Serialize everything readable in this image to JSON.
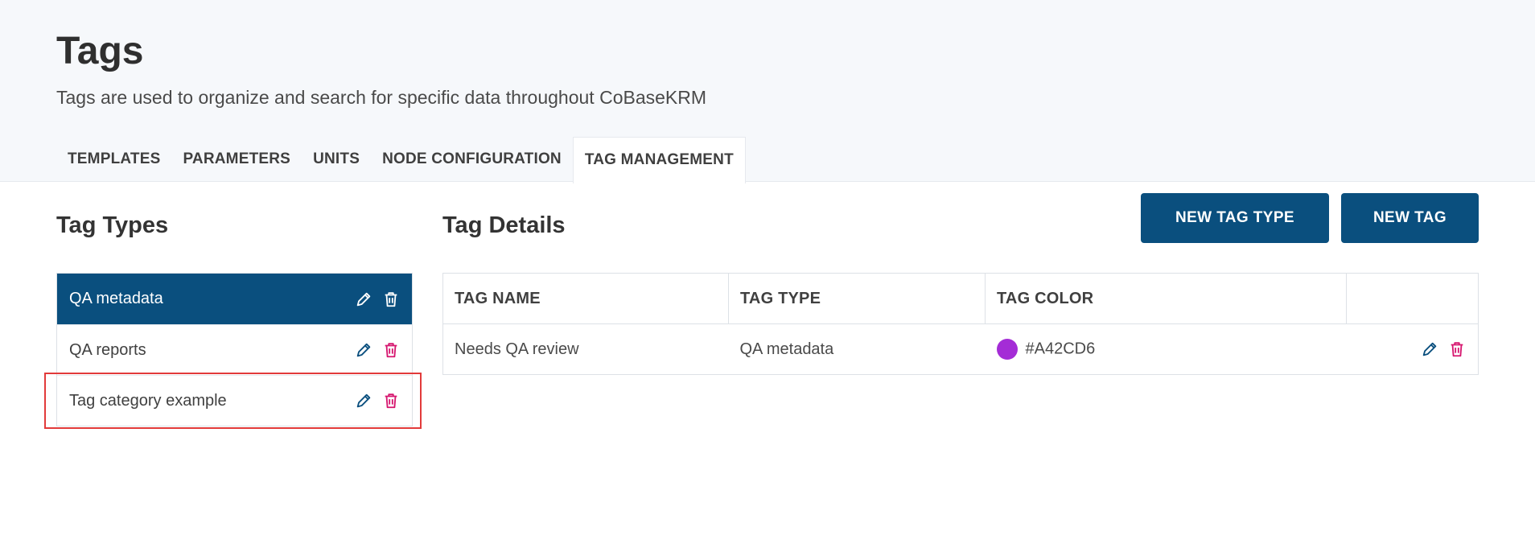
{
  "page": {
    "title": "Tags",
    "subtitle": "Tags are used to organize and search for specific data throughout CoBaseKRM"
  },
  "tabs": [
    {
      "label": "TEMPLATES",
      "active": false
    },
    {
      "label": "PARAMETERS",
      "active": false
    },
    {
      "label": "UNITS",
      "active": false
    },
    {
      "label": "NODE CONFIGURATION",
      "active": false
    },
    {
      "label": "TAG MANAGEMENT",
      "active": true
    }
  ],
  "tag_types": {
    "title": "Tag Types",
    "items": [
      {
        "label": "QA metadata",
        "selected": true
      },
      {
        "label": "QA reports",
        "selected": false
      },
      {
        "label": "Tag category example",
        "selected": false,
        "highlighted": true
      }
    ]
  },
  "tag_details": {
    "title": "Tag Details",
    "new_tag_type_label": "NEW TAG TYPE",
    "new_tag_label": "NEW TAG",
    "columns": [
      "TAG NAME",
      "TAG TYPE",
      "TAG COLOR",
      ""
    ],
    "rows": [
      {
        "name": "Needs QA review",
        "type": "QA metadata",
        "color": "#A42CD6"
      }
    ]
  },
  "icons": {
    "edit": "pencil-icon",
    "delete": "trash-icon"
  },
  "colors": {
    "primary": "#0a4f7e",
    "edit_icon": "#0a4f7e",
    "delete_icon": "#d6166f",
    "highlight": "#e23a3a"
  }
}
